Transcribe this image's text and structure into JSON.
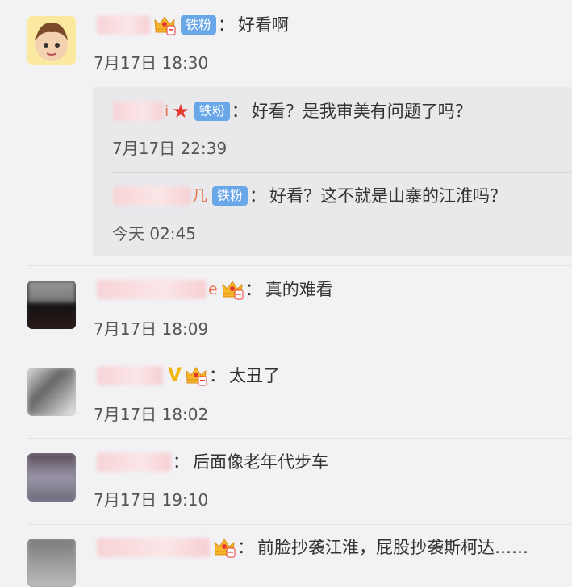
{
  "comments": [
    {
      "name_tail": "",
      "badge": "铁粉",
      "text": "好看啊",
      "time": "7月17日 18:30"
    },
    {
      "name_tail": "e",
      "badge": "",
      "text": "真的难看",
      "time": "7月17日 18:09"
    },
    {
      "name_tail": "",
      "badge": "",
      "vip": "V",
      "text": "太丑了",
      "time": "7月17日 18:02"
    },
    {
      "name_tail": "",
      "badge": "",
      "text": "后面像老年代步车",
      "time": "7月17日 19:10"
    },
    {
      "name_tail": "",
      "badge": "",
      "text": "前脸抄袭江淮，屁股抄袭斯柯达……",
      "time": ""
    }
  ],
  "replies": [
    {
      "name_tail": "i",
      "badge": "铁粉",
      "star": "★",
      "text": "好看？是我审美有问题了吗？",
      "time": "7月17日 22:39"
    },
    {
      "name_tail": "几",
      "badge": "铁粉",
      "text": "好看？这不就是山寨的江淮吗？",
      "time": "今天 02:45"
    }
  ],
  "colon": "：",
  "colors": {
    "badge": "#6aa7e8",
    "name": "#eb7350",
    "vip": "#f1b400",
    "star": "#e5382f"
  }
}
